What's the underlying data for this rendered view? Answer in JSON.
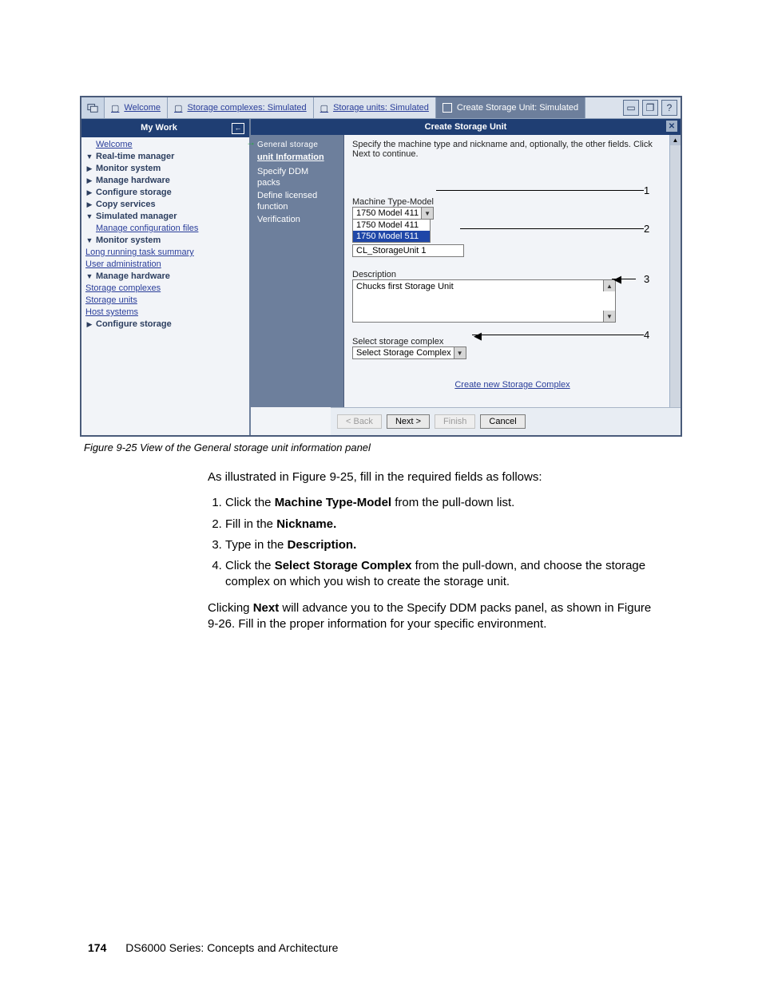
{
  "figure": {
    "tabs": {
      "welcome": "Welcome",
      "complexes": "Storage complexes: Simulated",
      "units": "Storage units: Simulated",
      "create": "Create Storage Unit: Simulated"
    },
    "sidebar": {
      "title": "My Work",
      "items": {
        "welcome": "Welcome",
        "rtm": "Real-time manager",
        "monitor": "Monitor system",
        "hw": "Manage hardware",
        "cfg": "Configure storage",
        "copy": "Copy services",
        "sim": "Simulated manager",
        "mcf": "Manage configuration files",
        "monitor2": "Monitor system",
        "lrt": "Long running task summary",
        "ua": "User administration",
        "hw2": "Manage hardware",
        "sc": "Storage complexes",
        "su": "Storage units",
        "hs": "Host systems",
        "cfg2": "Configure storage"
      }
    },
    "panel": {
      "title": "Create Storage Unit",
      "steps": {
        "s0_top": "General storage",
        "s0": "unit Information",
        "s1a": "Specify DDM",
        "s1b": "packs",
        "s2a": "Define licensed",
        "s2b": "function",
        "s3": "Verification"
      },
      "instr": "Specify the machine type and nickname and, optionally, the other fields. Click Next to continue.",
      "mtm_label": "Machine Type-Model",
      "mtm_sel": "1750 Model 411",
      "mtm_opts": {
        "o1": "1750 Model 411",
        "o2": "1750 Model 511"
      },
      "nick_value": "CL_StorageUnit 1",
      "desc_label": "Description",
      "desc_value": "Chucks first Storage Unit",
      "sel_label": "Select storage complex",
      "sel_value": "Select Storage Complex",
      "create_link": "Create new Storage Complex"
    },
    "buttons": {
      "back": "< Back",
      "next": "Next >",
      "finish": "Finish",
      "cancel": "Cancel"
    },
    "ann": {
      "a1": "1",
      "a2": "2",
      "a3": "3",
      "a4": "4"
    }
  },
  "caption": "Figure 9-25   View of the General storage unit information panel",
  "text": {
    "intro": "As illustrated in Figure 9-25, fill in the required fields as follows:",
    "li1_a": "Click the ",
    "li1_b": "Machine Type-Model",
    "li1_c": " from the pull-down list.",
    "li2_a": "Fill in the ",
    "li2_b": "Nickname.",
    "li3_a": "Type in the ",
    "li3_b": "Description.",
    "li4_a": "Click the ",
    "li4_b": "Select Storage Complex",
    "li4_c": " from the pull-down, and choose the storage complex on which you wish to create the storage unit.",
    "para_a": "Clicking ",
    "para_b": "Next",
    "para_c": " will advance you to the Specify DDM packs panel, as shown in Figure 9-26. Fill in the proper information for your specific environment."
  },
  "footer": {
    "page": "174",
    "title": "DS6000 Series: Concepts and Architecture"
  }
}
